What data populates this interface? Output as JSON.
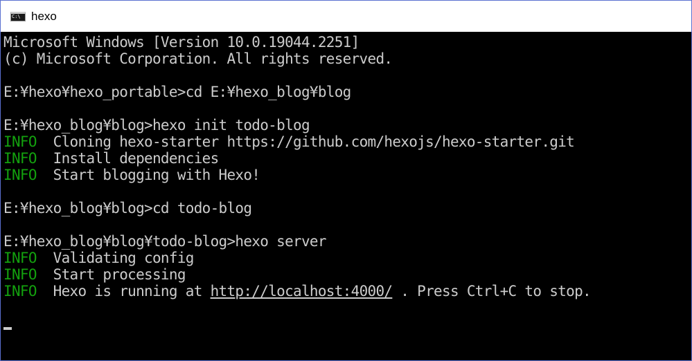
{
  "window": {
    "title": "hexo",
    "icon": "cmd-console-icon"
  },
  "colors": {
    "background": "#000000",
    "text": "#cccccc",
    "info": "#13a10e"
  },
  "console": {
    "header1": "Microsoft Windows [Version 10.0.19044.2251]",
    "header2": "(c) Microsoft Corporation. All rights reserved.",
    "prompt1": "E:¥hexo¥hexo_portable>",
    "cmd1": "cd E:¥hexo_blog¥blog",
    "prompt2": "E:¥hexo_blog¥blog>",
    "cmd2": "hexo init todo-blog",
    "info_tag": "INFO",
    "init_info": [
      "Cloning hexo-starter https://github.com/hexojs/hexo-starter.git",
      "Install dependencies",
      "Start blogging with Hexo!"
    ],
    "prompt3": "E:¥hexo_blog¥blog>",
    "cmd3": "cd todo-blog",
    "prompt4": "E:¥hexo_blog¥blog¥todo-blog>",
    "cmd4": "hexo server",
    "server_info": [
      "Validating config",
      "Start processing"
    ],
    "running_prefix": "Hexo is running at ",
    "running_url": "http://localhost:4000/",
    "running_suffix": " . Press Ctrl+C to stop."
  }
}
